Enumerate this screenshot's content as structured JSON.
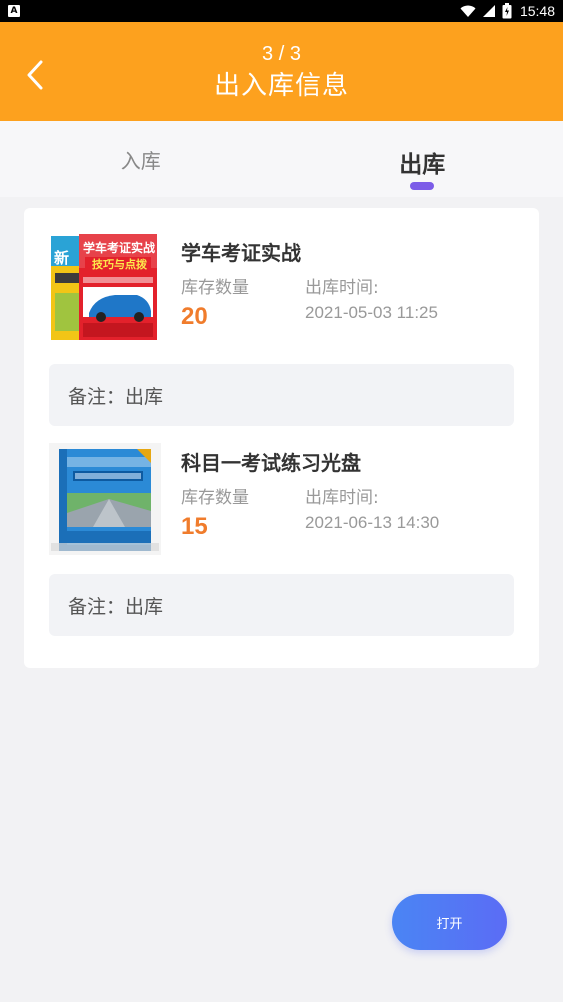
{
  "status_bar": {
    "time": "15:48",
    "icons": [
      "notification-a-icon",
      "wifi-icon",
      "signal-icon",
      "battery-icon"
    ]
  },
  "header": {
    "counter": "3 / 3",
    "title": "出入库信息",
    "background_color": "#fda11e"
  },
  "tabs": [
    {
      "label": "入库",
      "active": false
    },
    {
      "label": "出库",
      "active": true
    }
  ],
  "indicator_color": "#7c5ce8",
  "records": [
    {
      "name": "学车考证实战",
      "qty_label": "库存数量",
      "qty": "20",
      "time_label": "出库时间:",
      "time": "2021-05-03 11:25",
      "remark": "备注：出库",
      "image": "book-cover-xueche",
      "cover_text": "学车考证实战",
      "cover_subtext": "技巧与点拨"
    },
    {
      "name": "科目一考试练习光盘",
      "qty_label": "库存数量",
      "qty": "15",
      "time_label": "出库时间:",
      "time": "2021-06-13 14:30",
      "remark": "备注：出库",
      "image": "dvd-box-kemu1"
    }
  ],
  "open_button": {
    "label": "打开"
  },
  "accent_colors": {
    "quantity": "#f07c2c",
    "button_gradient_start": "#4a85f4",
    "button_gradient_end": "#5b6cf5"
  }
}
